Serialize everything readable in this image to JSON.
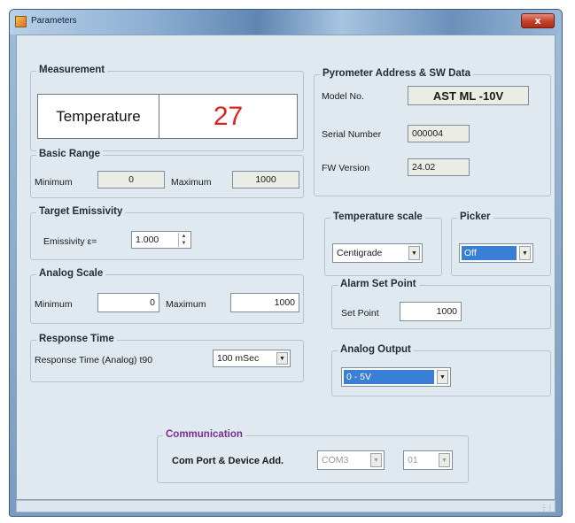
{
  "window": {
    "title": "Parameters",
    "close_label": "x"
  },
  "measurement": {
    "legend": "Measurement",
    "label": "Temperature",
    "value": "27"
  },
  "basic_range": {
    "legend": "Basic Range",
    "min_label": "Minimum",
    "min_value": "0",
    "max_label": "Maximum",
    "max_value": "1000"
  },
  "pyrometer": {
    "legend": "Pyrometer Address & SW Data",
    "model_label": "Model No.",
    "model_value": "AST ML -10V",
    "serial_label": "Serial Number",
    "serial_value": "000004",
    "fw_label": "FW Version",
    "fw_value": "24.02"
  },
  "emissivity": {
    "legend": "Target Emissivity",
    "label": "Emissivity ε=",
    "value": "1.000"
  },
  "temperature_scale": {
    "legend": "Temperature scale",
    "selected": "Centigrade"
  },
  "picker": {
    "legend": "Picker",
    "selected": "Off"
  },
  "analog_scale": {
    "legend": "Analog Scale",
    "min_label": "Minimum",
    "min_value": "0",
    "max_label": "Maximum",
    "max_value": "1000"
  },
  "alarm": {
    "legend": "Alarm Set Point",
    "label": "Set Point",
    "value": "1000"
  },
  "response_time": {
    "legend": "Response Time",
    "label": "Response Time  (Analog)  t90",
    "selected": "100 mSec"
  },
  "analog_output": {
    "legend": "Analog Output",
    "selected": "0 - 5V"
  },
  "communication": {
    "legend": "Communication",
    "label": "Com Port & Device Add.",
    "port": "COM3",
    "address": "01"
  },
  "colors": {
    "measurement_value": "#e02020",
    "selection": "#3a7fd6",
    "communication_legend": "#7a2e8a",
    "panel_background": "#dfe9ef"
  },
  "icons": [
    "window-app-icon",
    "close-icon",
    "chevron-down-icon",
    "spin-up-icon",
    "spin-down-icon",
    "resize-grip-icon"
  ]
}
